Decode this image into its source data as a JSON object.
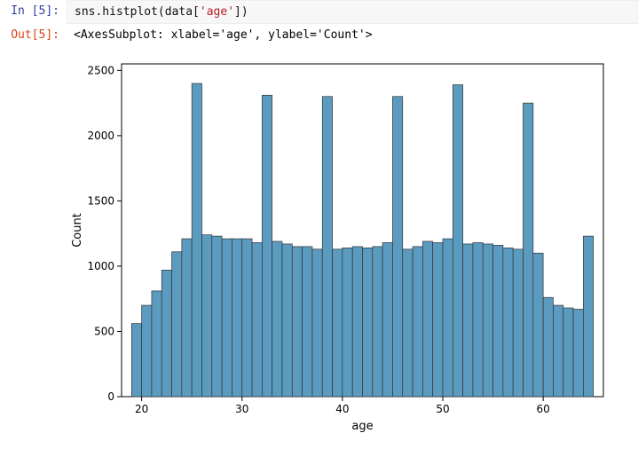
{
  "cell": {
    "in_prompt": "In [5]:",
    "out_prompt": "Out[5]:",
    "code_prefix": "sns.histplot(data[",
    "code_str": "'age'",
    "code_suffix": "])",
    "output_text": "<AxesSubplot: xlabel='age', ylabel='Count'>"
  },
  "chart_data": {
    "type": "bar",
    "title": "",
    "xlabel": "age",
    "ylabel": "Count",
    "xlim": [
      18,
      66
    ],
    "ylim": [
      0,
      2550
    ],
    "x_ticks": [
      20,
      30,
      40,
      50,
      60
    ],
    "y_ticks": [
      0,
      500,
      1000,
      1500,
      2000,
      2500
    ],
    "bin_edges": [
      19,
      20,
      21,
      22,
      23,
      24,
      25,
      26,
      27,
      28,
      29,
      30,
      31,
      32,
      33,
      34,
      35,
      36,
      37,
      38,
      39,
      40,
      41,
      42,
      43,
      44,
      45,
      46,
      47,
      48,
      49,
      50,
      51,
      52,
      53,
      54,
      55,
      56,
      57,
      58,
      59,
      60,
      61,
      62,
      63,
      64,
      65
    ],
    "values": [
      560,
      700,
      810,
      970,
      1110,
      1210,
      2400,
      1240,
      1230,
      1210,
      1210,
      1210,
      1180,
      2310,
      1190,
      1170,
      1150,
      1150,
      1130,
      2300,
      1130,
      1140,
      1150,
      1140,
      1150,
      1180,
      2300,
      1130,
      1150,
      1190,
      1180,
      1210,
      2390,
      1170,
      1180,
      1170,
      1160,
      1140,
      1130,
      2250,
      1100,
      760,
      700,
      680,
      670,
      1230
    ]
  }
}
